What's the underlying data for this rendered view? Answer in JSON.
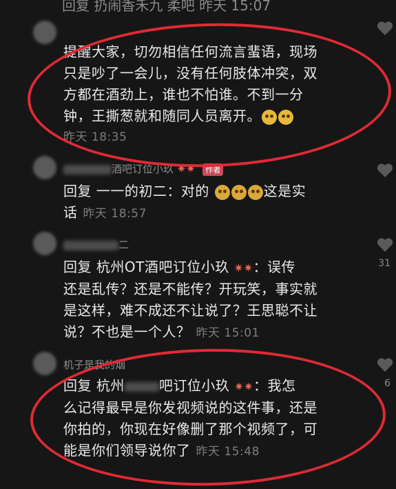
{
  "top_fragment": "回复 扔闹香禾九 柔吧 昨天 15:07",
  "comments": [
    {
      "lines": [
        "提醒大家，切勿相信任何流言蜚语，现场",
        "只是吵了一会儿，没有任何肢体冲突，双",
        "方都在酒劲上，谁也不怕谁。不到一分",
        "钟，王撕葱就和随同人员离开。"
      ],
      "time": "昨天 18:35"
    },
    {
      "username": "酒吧订位小玖",
      "badge": "作者",
      "line1": "回复 一一的初二：对的",
      "line1_tail": "这是实",
      "line2": "话",
      "time": "昨天 18:57"
    },
    {
      "username": "二",
      "line1_prefix": "回复 杭州OT酒吧订位小玖",
      "line1_suffix": "：误传",
      "lines": [
        "还是乱传？还是不能传？开玩笑，事实就",
        "是这样，难不成还不让说了？王思聪不让",
        "说？不也是一个人？"
      ],
      "time": "昨天 15:01",
      "likes": "31"
    },
    {
      "username": "机子是我的烟",
      "line1_prefix": "回复 杭州",
      "line1_mid": "吧订位小玖",
      "line1_suffix": "：我怎",
      "lines": [
        "么记得最早是你发视频说的这件事，还是",
        "你拍的，你现在好像删了那个视频了，可",
        "能是你们领导说你了"
      ],
      "time": "昨天 15:48",
      "likes": "6"
    }
  ],
  "colors": {
    "highlight": "#e02a35",
    "spark": "#e0685a",
    "badge": "#c94a5a"
  }
}
